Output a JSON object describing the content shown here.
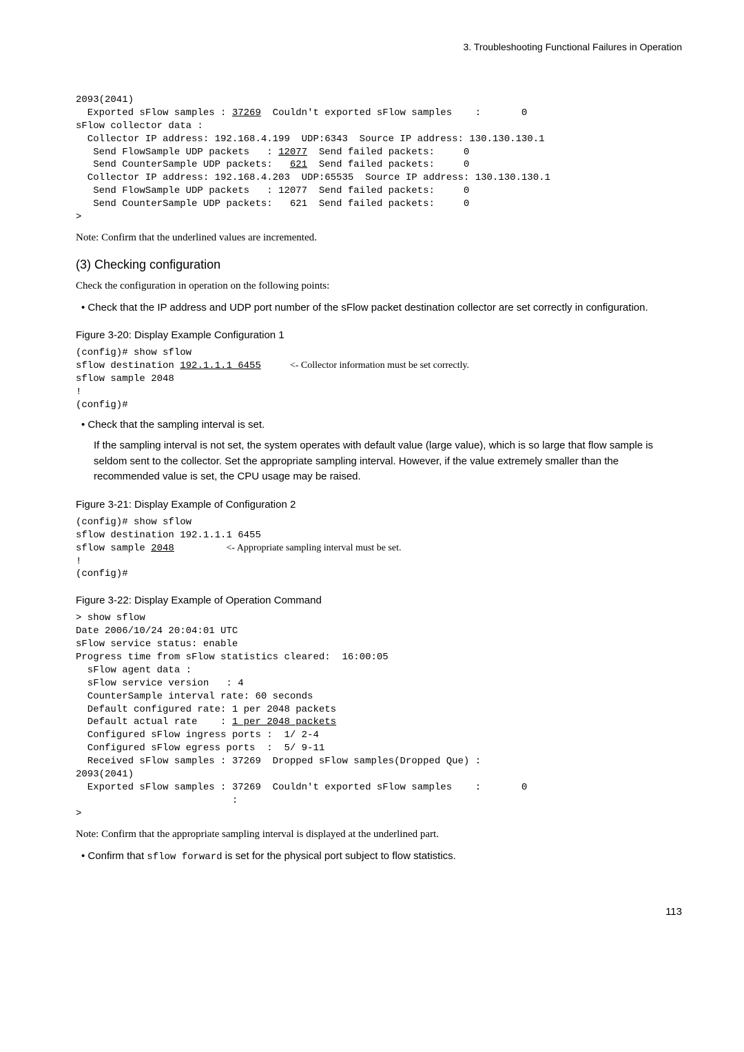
{
  "header": {
    "chapter": "3.   Troubleshooting Functional Failures in Operation"
  },
  "code1": {
    "l1": "2093(2041)",
    "l2a": "  Exported sFlow samples : ",
    "l2u": "37269",
    "l2b": "  Couldn't exported sFlow samples    :       0",
    "l3": "sFlow collector data :",
    "l4": "  Collector IP address: 192.168.4.199  UDP:6343  Source IP address: 130.130.130.1",
    "l5a": "   Send FlowSample UDP packets   : ",
    "l5u": "12077",
    "l5b": "  Send failed packets:     0",
    "l6a": "   Send CounterSample UDP packets:   ",
    "l6u": "621",
    "l6b": "  Send failed packets:     0",
    "l7": "  Collector IP address: 192.168.4.203  UDP:65535  Source IP address: 130.130.130.1",
    "l8": "   Send FlowSample UDP packets   : 12077  Send failed packets:     0",
    "l9": "   Send CounterSample UDP packets:   621  Send failed packets:     0",
    "l10": ">"
  },
  "note1": "Note: Confirm that the underlined values are incremented.",
  "section3": {
    "title": "(3)   Checking configuration",
    "intro": "Check the configuration in operation on the following points:",
    "bullet1": "Check that the IP address and UDP port number of the sFlow packet destination collector are set correctly in configuration."
  },
  "fig320": {
    "caption": "Figure 3-20: Display Example Configuration 1",
    "l1": "(config)# show sflow",
    "l2a": "sflow destination ",
    "l2u": "192.1.1.1 6455",
    "l2b": "     ",
    "l2c": "<- Collector information must be set correctly.",
    "l3": "sflow sample 2048",
    "l4": "!",
    "l5": "(config)#"
  },
  "bullet2": {
    "heading": "Check that the sampling interval is set.",
    "body": "If the sampling interval is not set, the system operates with default value (large value), which is so large that flow sample is seldom sent to the collector. Set the appropriate sampling interval. However, if the value extremely smaller than the recommended value is set, the CPU usage may be raised."
  },
  "fig321": {
    "caption": "Figure 3-21: Display Example of Configuration 2",
    "l1": "(config)# show sflow",
    "l2": "sflow destination 192.1.1.1 6455",
    "l3a": "sflow sample ",
    "l3u": "2048",
    "l3b": "         ",
    "l3c": "<- Appropriate sampling interval must be set.",
    "l4": "!",
    "l5": "(config)#"
  },
  "fig322": {
    "caption": "Figure 3-22: Display Example of Operation Command",
    "l1": "> show sflow",
    "l2": "Date 2006/10/24 20:04:01 UTC",
    "l3": "sFlow service status: enable",
    "l4": "Progress time from sFlow statistics cleared:  16:00:05",
    "l5": "  sFlow agent data :",
    "l6": "  sFlow service version   : 4",
    "l7": "  CounterSample interval rate: 60 seconds",
    "l8": "  Default configured rate: 1 per 2048 packets",
    "l9a": "  Default actual rate    : ",
    "l9u": "1 per 2048 packets",
    "l10": "  Configured sFlow ingress ports :  1/ 2-4",
    "l11": "  Configured sFlow egress ports  :  5/ 9-11",
    "l12": "  Received sFlow samples : 37269  Dropped sFlow samples(Dropped Que) :",
    "l13": "2093(2041)",
    "l14": "  Exported sFlow samples : 37269  Couldn't exported sFlow samples    :       0",
    "l15": "                           :",
    "l16": ">"
  },
  "note2": "Note: Confirm that the appropriate sampling interval is displayed at the underlined part.",
  "bullet3a": "Confirm that ",
  "bullet3code": "sflow forward",
  "bullet3b": " is set for the physical port subject to flow statistics.",
  "pagenum": "113"
}
